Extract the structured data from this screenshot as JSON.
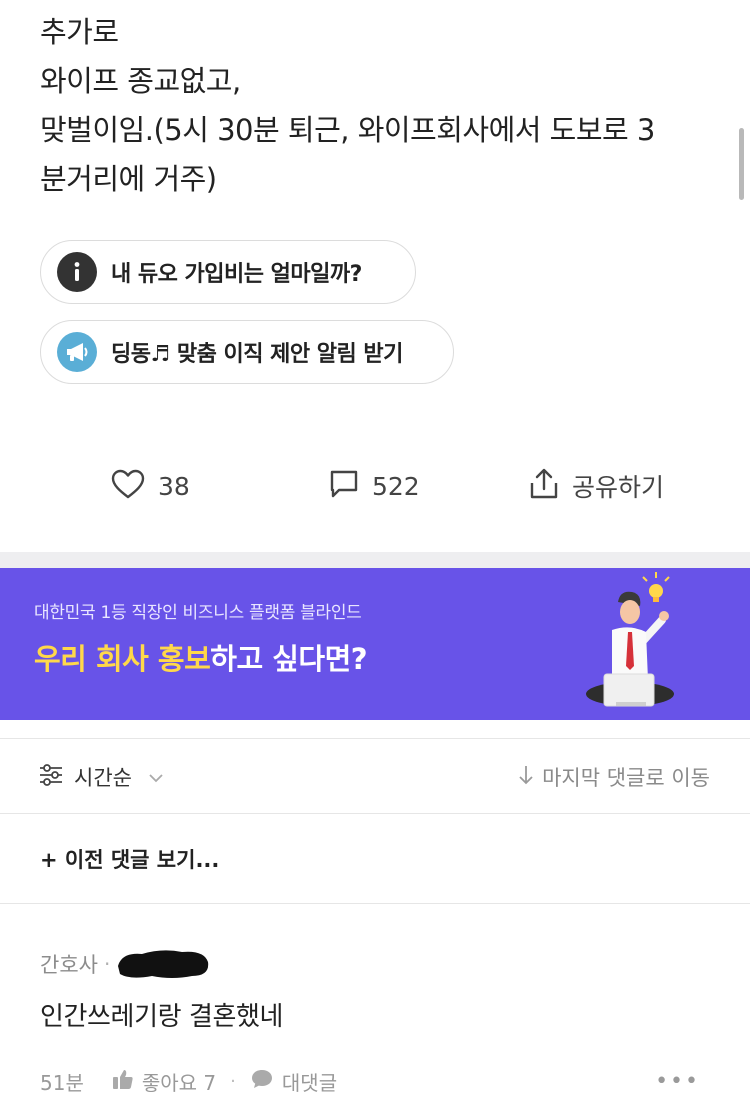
{
  "post": {
    "lines": [
      "추가로",
      "와이프 종교없고,",
      "맞벌이임.(5시 30분 퇴근, 와이프회사에서 도보로 3",
      "분거리에 거주)"
    ]
  },
  "chips": [
    {
      "label": "내 듀오 가입비는 얼마일까?",
      "icon": "info-icon"
    },
    {
      "label": "딩동♬ 맞춤 이직 제안 알림 받기",
      "icon": "megaphone-icon"
    }
  ],
  "actions": {
    "likes": "38",
    "comments": "522",
    "share": "공유하기"
  },
  "banner": {
    "subtitle": "대한민국 1등 직장인 비즈니스 플랫폼 블라인드",
    "title_highlight": "우리 회사 홍보",
    "title_rest": "하고 싶다면?",
    "highlight_color": "#ffd84a",
    "background_color": "#6853e8"
  },
  "sort": {
    "label": "시간순",
    "jump_label": "마지막 댓글로 이동"
  },
  "previous_comments": "+ 이전 댓글 보기...",
  "comment": {
    "company": "간호사",
    "text": "인간쓰레기랑 결혼했네",
    "time": "51분",
    "like_label": "좋아요 7",
    "reply_label": "대댓글",
    "more": "•••"
  }
}
